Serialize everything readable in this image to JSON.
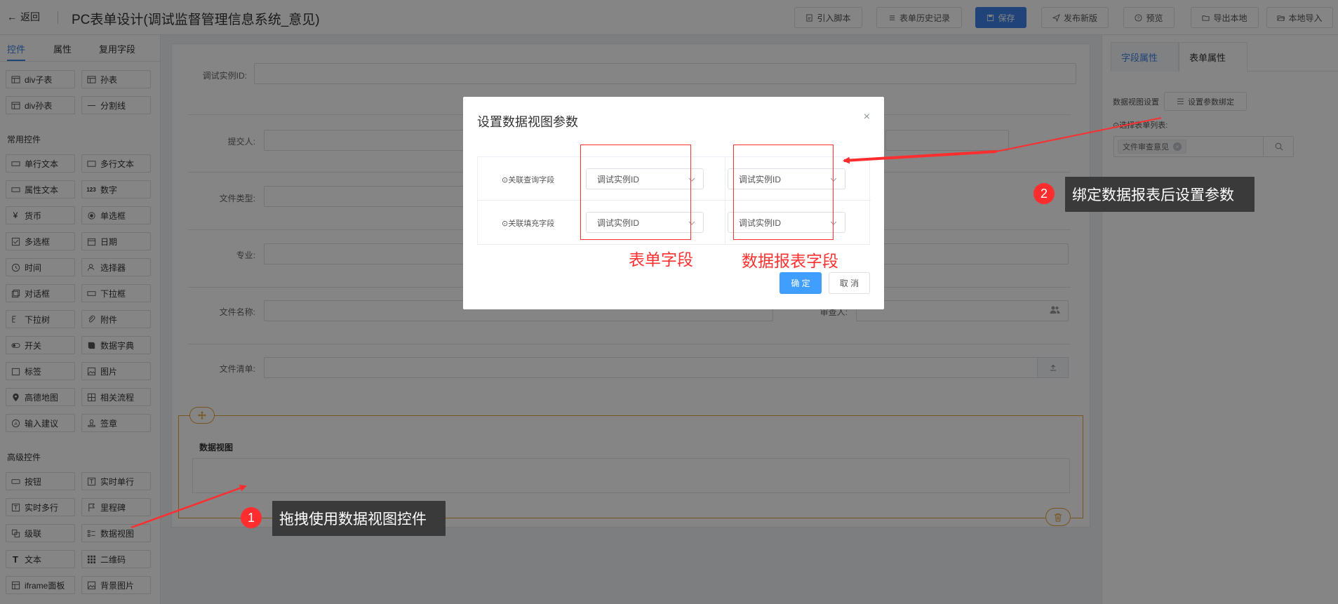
{
  "header": {
    "back_label": "返回",
    "title": "PC表单设计(调试监督管理信息系统_意见)",
    "buttons": {
      "import_script": "引入脚本",
      "history": "表单历史记录",
      "save": "保存",
      "publish": "发布新版",
      "preview": "预览",
      "export": "导出本地",
      "import_local": "本地导入"
    }
  },
  "left_panel": {
    "tabs": [
      "控件",
      "属性",
      "复用字段"
    ],
    "top_items": [
      "div子表",
      "孙表",
      "div孙表",
      "分割线"
    ],
    "common_section": "常用控件",
    "common_items": [
      "单行文本",
      "多行文本",
      "属性文本",
      "数字",
      "货币",
      "单选框",
      "多选框",
      "日期",
      "时间",
      "选择器",
      "对话框",
      "下拉框",
      "下拉树",
      "附件",
      "开关",
      "数据字典",
      "标签",
      "图片",
      "高德地图",
      "相关流程",
      "输入建议",
      "签章"
    ],
    "advanced_section": "高级控件",
    "advanced_items": [
      "按钮",
      "实时单行",
      "实时多行",
      "里程碑",
      "级联",
      "数据视图",
      "文本",
      "二维码",
      "iframe面板",
      "背景图片"
    ]
  },
  "form": {
    "fields": {
      "debug_instance_id": "调试实例ID:",
      "submitter": "提交人:",
      "file_type": "文件类型:",
      "major": "专业:",
      "file_name": "文件名称:",
      "reviewer": "审查人:",
      "file_list": "文件清单:"
    },
    "data_view_title": "数据视图"
  },
  "right_panel": {
    "tabs": [
      "字段属性",
      "表单属性"
    ],
    "data_view_setting_label": "数据视图设置",
    "bind_params_button": "设置参数绑定",
    "select_list_label": "选择表单列表:",
    "selected_tag": "文件审查意见"
  },
  "modal": {
    "title": "设置数据视图参数",
    "close": "×",
    "rows": [
      {
        "label": "关联查询字段",
        "form_field": "调试实例ID",
        "report_field": "调试实例ID"
      },
      {
        "label": "关联填充字段",
        "form_field": "调试实例ID",
        "report_field": "调试实例ID"
      }
    ],
    "confirm": "确 定",
    "cancel": "取 消"
  },
  "annotations": {
    "form_field_label": "表单字段",
    "report_field_label": "数据报表字段",
    "step1": {
      "num": "1",
      "text": "拖拽使用数据视图控件"
    },
    "step2": {
      "num": "2",
      "text": "绑定数据报表后设置参数"
    }
  },
  "colors": {
    "primary": "#3f80e8",
    "annotation_red": "#ff3030",
    "highlight_border": "#e6a23c"
  }
}
